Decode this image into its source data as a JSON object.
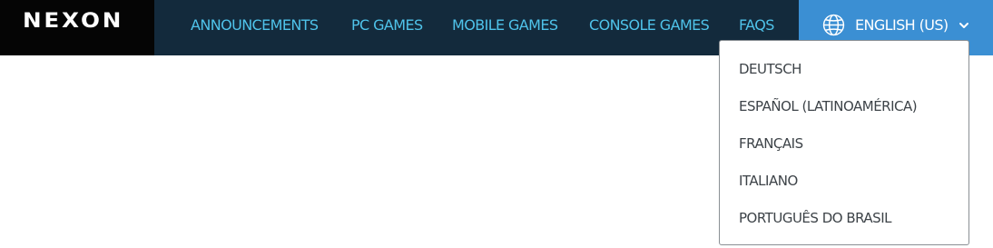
{
  "brand": {
    "logo_text": "NEXON"
  },
  "nav": {
    "items": [
      {
        "label": "ANNOUNCEMENTS"
      },
      {
        "label": "PC GAMES"
      },
      {
        "label": "MOBILE GAMES"
      },
      {
        "label": "CONSOLE GAMES"
      },
      {
        "label": "FAQS"
      }
    ]
  },
  "language": {
    "selected": "ENGLISH (US)",
    "icon": "globe-icon",
    "chevron": "chevron-down-icon",
    "options": [
      {
        "label": "DEUTSCH"
      },
      {
        "label": "ESPAÑOL (LATINOAMÉRICA)"
      },
      {
        "label": "FRANÇAIS"
      },
      {
        "label": "ITALIANO"
      },
      {
        "label": "PORTUGUÊS DO BRASIL"
      }
    ]
  },
  "colors": {
    "header_bg": "#132a3c",
    "logo_bg": "#050505",
    "nav_text": "#4fc3ea",
    "language_button_bg": "#3b8fd3",
    "dropdown_text": "#3d4348"
  }
}
